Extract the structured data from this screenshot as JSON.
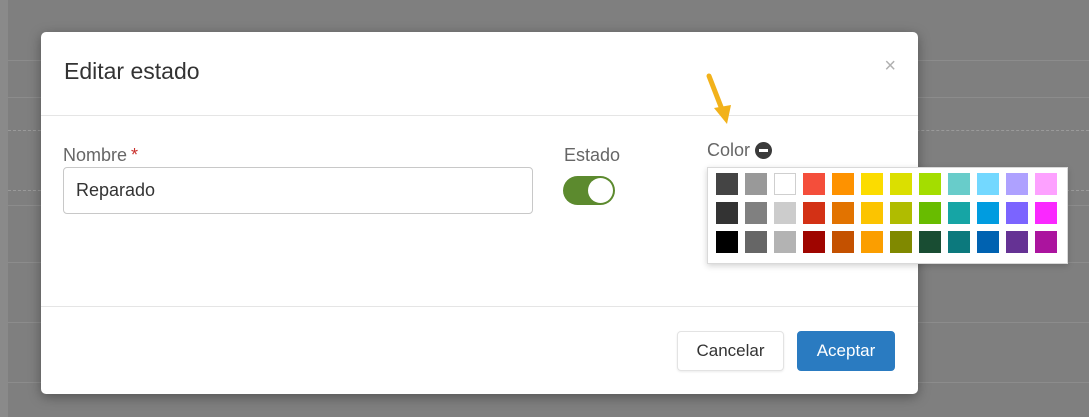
{
  "dialog": {
    "title": "Editar estado",
    "close_symbol": "×"
  },
  "form": {
    "name_label": "Nombre",
    "required_marker": "*",
    "name_value": "Reparado",
    "status_label": "Estado",
    "status_enabled": true,
    "color_label": "Color"
  },
  "palette": {
    "selected_color": "#848b00",
    "rows": [
      [
        "#444444",
        "#999999",
        "#ffffff",
        "#f44e3b",
        "#fe9200",
        "#fcdc00",
        "#dbdf00",
        "#a4dd00",
        "#68ccca",
        "#73d8ff",
        "#aea1ff",
        "#fda1ff"
      ],
      [
        "#333333",
        "#808080",
        "#cccccc",
        "#d33115",
        "#e27300",
        "#fcc400",
        "#b0bc00",
        "#68bc00",
        "#16a5a5",
        "#009ce0",
        "#7b64ff",
        "#fa28ff"
      ],
      [
        "#000000",
        "#666666",
        "#b3b3b3",
        "#9f0500",
        "#c45100",
        "#fb9e00",
        "#808900",
        "#194d33",
        "#0c797d",
        "#0062b1",
        "#653294",
        "#ab149e"
      ]
    ]
  },
  "footer": {
    "cancel_label": "Cancelar",
    "accept_label": "Aceptar"
  },
  "colors": {
    "toggle_on": "#5c8a2e",
    "primary": "#2a7bc1",
    "annotation_arrow": "#f2b21b"
  },
  "icons": {
    "close": "close-icon",
    "remove_color": "minus-circle-icon",
    "annotation": "arrow-annotation-icon"
  }
}
